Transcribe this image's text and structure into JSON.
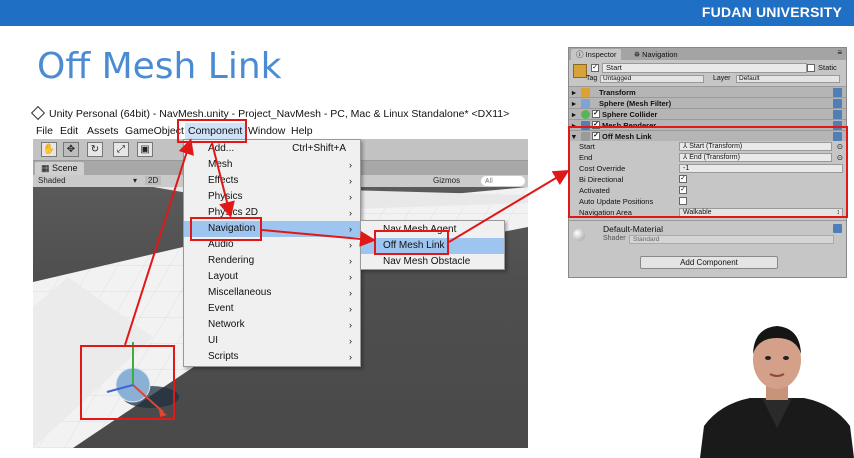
{
  "header": {
    "university": "FUDAN UNIVERSITY",
    "slide_title": "Off Mesh Link"
  },
  "unity": {
    "window_title": "Unity Personal (64bit) - NavMesh.unity - Project_NavMesh - PC, Mac & Linux Standalone* <DX11>",
    "menu": [
      "File",
      "Edit",
      "Assets",
      "GameObject",
      "Component",
      "Window",
      "Help"
    ],
    "scene_tab": "Scene",
    "shading": "Shaded",
    "mode_2d": "2D",
    "gizmos": "Gizmos",
    "search_placeholder": "All"
  },
  "component_menu": {
    "items": [
      {
        "label": "Add...",
        "shortcut": "Ctrl+Shift+A",
        "submenu": false
      },
      {
        "label": "Mesh",
        "shortcut": "",
        "submenu": true
      },
      {
        "label": "Effects",
        "shortcut": "",
        "submenu": true
      },
      {
        "label": "Physics",
        "shortcut": "",
        "submenu": true
      },
      {
        "label": "Physics 2D",
        "shortcut": "",
        "submenu": true
      },
      {
        "label": "Navigation",
        "shortcut": "",
        "submenu": true
      },
      {
        "label": "Audio",
        "shortcut": "",
        "submenu": true
      },
      {
        "label": "Rendering",
        "shortcut": "",
        "submenu": true
      },
      {
        "label": "Layout",
        "shortcut": "",
        "submenu": true
      },
      {
        "label": "Miscellaneous",
        "shortcut": "",
        "submenu": true
      },
      {
        "label": "Event",
        "shortcut": "",
        "submenu": true
      },
      {
        "label": "Network",
        "shortcut": "",
        "submenu": true
      },
      {
        "label": "UI",
        "shortcut": "",
        "submenu": true
      },
      {
        "label": "Scripts",
        "shortcut": "",
        "submenu": true
      }
    ],
    "highlighted": "Navigation"
  },
  "navigation_menu": {
    "items": [
      "Nav Mesh Agent",
      "Off Mesh Link",
      "Nav Mesh Obstacle"
    ],
    "highlighted": "Off Mesh Link"
  },
  "inspector": {
    "tabs": [
      "Inspector",
      "Navigation"
    ],
    "object_name": "Start",
    "static_label": "Static",
    "tag_label": "Tag",
    "tag_value": "Untagged",
    "layer_label": "Layer",
    "layer_value": "Default",
    "components": [
      "Transform",
      "Sphere (Mesh Filter)",
      "Sphere Collider",
      "Mesh Renderer",
      "Off Mesh Link"
    ],
    "off_mesh_link": {
      "start_label": "Start",
      "start_value": "Start (Transform)",
      "end_label": "End",
      "end_value": "End (Transform)",
      "cost_label": "Cost Override",
      "cost_value": "-1",
      "bidir_label": "Bi Directional",
      "bidir": true,
      "activated_label": "Activated",
      "activated": true,
      "auto_update_label": "Auto Update Positions",
      "auto_update": false,
      "nav_area_label": "Navigation Area",
      "nav_area_value": "Walkable"
    },
    "material_name": "Default-Material",
    "shader_label": "Shader",
    "shader_value": "Standard",
    "add_component": "Add Component"
  },
  "colors": {
    "brand_blue": "#1f6fc5",
    "title_blue": "#4a8bd4",
    "highlight_red": "#e01818",
    "menu_highlight": "#9ec5f0"
  }
}
